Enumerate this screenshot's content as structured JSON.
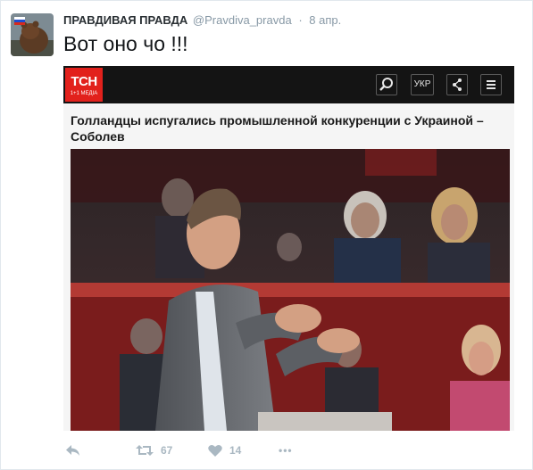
{
  "tweet": {
    "author_name": "ПРАВДИВАЯ ПРАВДА",
    "author_handle": "@Pravdiva_pravda",
    "separator": "·",
    "timestamp": "8 апр.",
    "text": "Вот оно чо !!!"
  },
  "embed": {
    "logo_big": "ТСН",
    "logo_small": "1+1 МЕДІА",
    "lang_label": "УКР",
    "headline": "Голландцы испугались промышленной конкуренции с Украиной – Соболев",
    "icons": [
      "search-icon",
      "share-icon",
      "menu-icon"
    ]
  },
  "actions": {
    "retweet_count": "67",
    "like_count": "14",
    "more_label": "•••"
  },
  "colors": {
    "tsn_red": "#e2211c",
    "bar_dark": "#141414",
    "action_gray": "#aab8c2",
    "handle_gray": "#8899a6"
  }
}
